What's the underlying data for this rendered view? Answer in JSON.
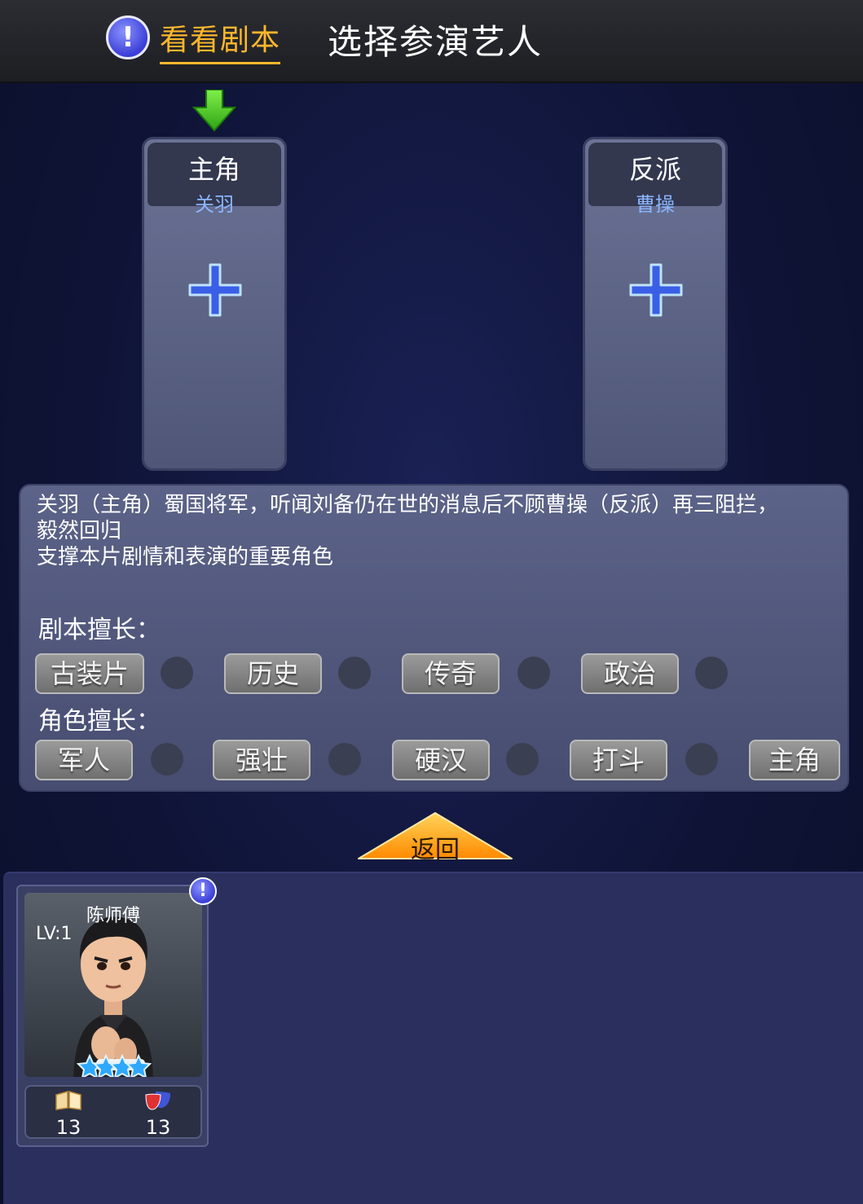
{
  "header": {
    "info_icon": "exclamation-icon",
    "script_link": "看看剧本",
    "title": "选择参演艺人"
  },
  "slots": [
    {
      "role": "主角",
      "character": "关羽",
      "icon": "plus-icon"
    },
    {
      "role": "反派",
      "character": "曹操",
      "icon": "plus-icon"
    }
  ],
  "description": {
    "lines": [
      "关羽（主角）蜀国将军，听闻刘备仍在世的消息后不顾曹操（反派）再三阻拦，",
      "毅然回归",
      "支撑本片剧情和表演的重要角色"
    ],
    "script_skills_label": "剧本擅长：",
    "script_skills": [
      "古装片",
      "历史",
      "传奇",
      "政治"
    ],
    "role_skills_label": "角色擅长：",
    "role_skills": [
      "军人",
      "强壮",
      "硬汉",
      "打斗",
      "主角"
    ]
  },
  "back_button": "返回",
  "actors": [
    {
      "name": "陈师傅",
      "level": "LV:1",
      "stars": 4,
      "stat1": "13",
      "stat1_icon": "book-icon",
      "stat2": "13",
      "stat2_icon": "drama-mask-icon"
    }
  ],
  "colors": {
    "accent": "#ffb72b",
    "character_name": "#8bb6ff",
    "arrow": "#4fd22a"
  }
}
